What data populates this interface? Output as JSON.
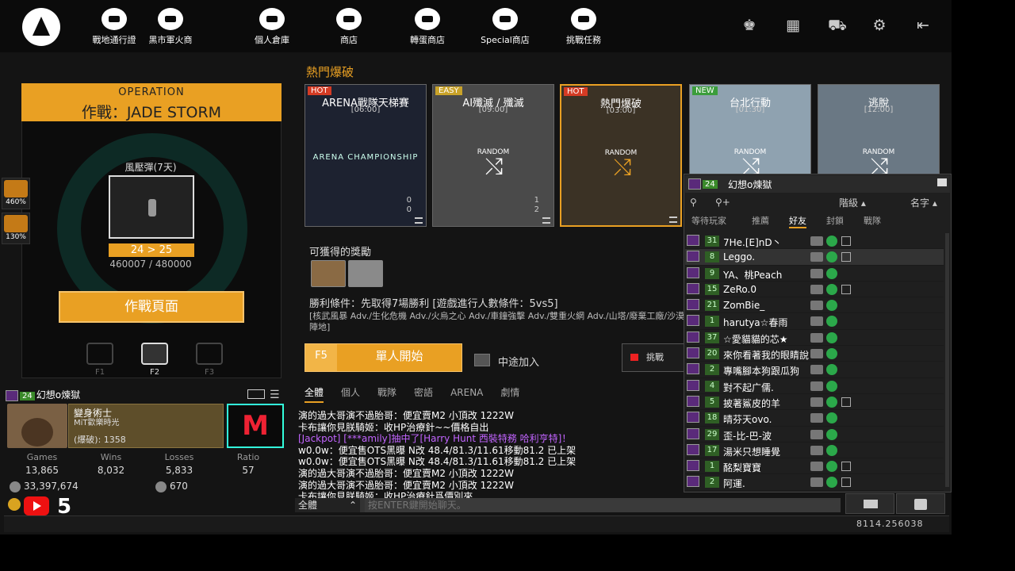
{
  "topnav": {
    "items": [
      {
        "label": "戰地通行證",
        "icon": "battle-pass-icon"
      },
      {
        "label": "黑市軍火商",
        "icon": "black-market-icon"
      },
      {
        "label": "個人倉庫",
        "icon": "inventory-icon"
      },
      {
        "label": "商店",
        "icon": "shop-icon"
      },
      {
        "label": "轉蛋商店",
        "icon": "gacha-icon"
      },
      {
        "label": "Special商店",
        "icon": "special-shop-icon"
      },
      {
        "label": "挑戰任務",
        "icon": "challenge-mission-icon"
      }
    ],
    "right_icons": [
      "ranking-icon",
      "calendar-icon",
      "cart-icon",
      "gear-icon",
      "exit-icon"
    ]
  },
  "operation": {
    "header": "OPERATION",
    "title": "作戰：JADE STORM",
    "item_name": "風壓彈(7天)",
    "level": "24 > 25",
    "exp": "460007 / 480000",
    "button": "作戰頁面"
  },
  "boosts": [
    {
      "value": "460%"
    },
    {
      "value": "130%"
    }
  ],
  "fkeys": [
    {
      "label": "F1",
      "icon": "rifle-mode-icon"
    },
    {
      "label": "F2",
      "icon": "ammo-mode-icon"
    },
    {
      "label": "F3",
      "icon": "crosshair-mode-icon"
    }
  ],
  "profile": {
    "level": "24",
    "name": "幻想o煉獄",
    "rank_title": "變身術士",
    "rank_sub": "MiT歡樂時光",
    "rank_stat": "(爆破): 1358",
    "stats": [
      {
        "label": "Games",
        "value": "13,865"
      },
      {
        "label": "Wins",
        "value": "8,032"
      },
      {
        "label": "Losses",
        "value": "5,833"
      },
      {
        "label": "Ratio",
        "value": "57"
      }
    ],
    "gold": "33,397,674",
    "silver": "670",
    "cash_count": "5"
  },
  "modes": {
    "section_title": "熱門爆破",
    "items": [
      {
        "tag": "HOT",
        "tag_color": "#d43b24",
        "title": "ARENA戰隊天梯賽",
        "time": "[06:00]",
        "top": "0",
        "bottom": "0"
      },
      {
        "tag": "EASY",
        "tag_color": "#c9a32a",
        "title": "AI殲滅 / 殲滅",
        "time": "[09:00]",
        "top": "1",
        "bottom": "2"
      },
      {
        "tag": "HOT",
        "tag_color": "#d43b24",
        "title": "熱門爆破",
        "time": "[03:00]",
        "top": "",
        "bottom": ""
      },
      {
        "tag": "NEW",
        "tag_color": "#3b9d3b",
        "title": "台北行動",
        "time": "[01:30]",
        "top": "",
        "bottom": ""
      },
      {
        "tag": "",
        "tag_color": "",
        "title": "逃脫",
        "time": "[12:00]",
        "top": "",
        "bottom": ""
      }
    ],
    "random_label": "RANDOM",
    "arena_logo": "ARENA CHAMPIONSHIP"
  },
  "rewards": {
    "label": "可獲得的獎勵",
    "win_condition": "勝利條件：先取得7場勝利 [遊戲進行人數條件：5vs5]",
    "maps": "[核武風暴 Adv./生化危機 Adv./火烏之心 Adv./車鐘強擊 Adv./雙重火網 Adv./山塔/廢棄工廠/沙漠陣地]"
  },
  "start": {
    "key": "F5",
    "label": "單人開始",
    "join_label": "中途加入",
    "challenge_label": "挑戰"
  },
  "chat": {
    "tabs": [
      "全體",
      "個人",
      "戰隊",
      "密語",
      "ARENA",
      "劇情"
    ],
    "messages": [
      {
        "text": "演的過大哥演不過胎哥：便宜賣M2 小頂改 1222W",
        "color": "#ffffff"
      },
      {
        "text": "卡布讓你見朕騎姬：收HP治療針~~價格自出",
        "color": "#ffffff"
      },
      {
        "text": "[Jackpot] [***amily]抽中了[Harry Hunt 西裝特務 哈利亨特]！",
        "color": "#c264ff"
      },
      {
        "text": "w0.0w：便宜售OTS黑曝 N改 48.4/81.3/11.61移動81.2 已上架",
        "color": "#ffffff"
      },
      {
        "text": "w0.0w：便宜售OTS黑曝 N改 48.4/81.3/11.61移動81.2 已上架",
        "color": "#ffffff"
      },
      {
        "text": "演的過大哥演不過胎哥：便宜賣M2 小頂改 1222W",
        "color": "#ffffff"
      },
      {
        "text": "演的過大哥演不過胎哥：便宜賣M2 小頂改 1222W",
        "color": "#ffffff"
      },
      {
        "text": "卡布讓你見朕騎姬：收HP治療針爲價別來",
        "color": "#ffffff"
      }
    ],
    "channel": "全體",
    "input_placeholder": "按ENTER鍵開始聊天。"
  },
  "friends_panel": {
    "level": "24",
    "name": "幻想o煉獄",
    "sort_rank": "階級",
    "sort_name": "名字",
    "tabs": [
      "等待玩家",
      "推薦",
      "好友",
      "封鎖",
      "戰隊"
    ],
    "friends": [
      {
        "level": "31",
        "name": "7He.[E]nD丶"
      },
      {
        "level": "8",
        "name": "Leggo."
      },
      {
        "level": "9",
        "name": "YA、桃Peach"
      },
      {
        "level": "15",
        "name": "ZeRo.0"
      },
      {
        "level": "21",
        "name": "ZomBie_"
      },
      {
        "level": "1",
        "name": "harutya☆春雨"
      },
      {
        "level": "37",
        "name": "☆愛貓貓的芯★"
      },
      {
        "level": "20",
        "name": "來你看著我的眼睛說"
      },
      {
        "level": "2",
        "name": "專嘴腳本狗跟瓜狗"
      },
      {
        "level": "4",
        "name": "對不起广儒."
      },
      {
        "level": "5",
        "name": "披著鯊皮的羊"
      },
      {
        "level": "18",
        "name": "晴芬天ovo."
      },
      {
        "level": "29",
        "name": "歪-比-巴-波"
      },
      {
        "level": "17",
        "name": "湯米只想睡覺"
      },
      {
        "level": "1",
        "name": "酩梨寶寶"
      },
      {
        "level": "2",
        "name": "阿運."
      }
    ]
  },
  "coords": "8114.256038"
}
